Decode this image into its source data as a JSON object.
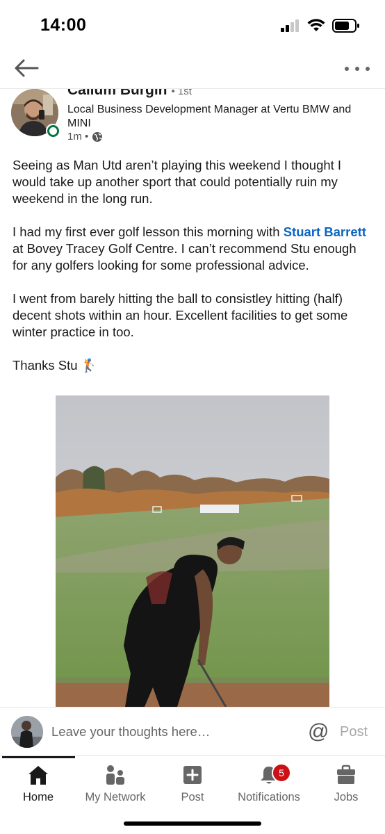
{
  "status_bar": {
    "time": "14:00"
  },
  "top_nav": {
    "back_icon": "arrow-left-icon",
    "more_icon": "more-horizontal-icon"
  },
  "post": {
    "author": {
      "name": "Callum Burgin",
      "degree": "• 1st",
      "headline": "Local Business Development Manager at Vertu BMW and MINI",
      "time": "1m •",
      "visibility_icon": "globe-icon"
    },
    "body": {
      "p1": "Seeing as Man Utd aren’t playing this weekend I thought I would take up another sport that could potentially ruin my weekend in the long run.",
      "p2_before": "I had my first ever golf lesson this morning with ",
      "p2_mention": "Stuart Barrett",
      "p2_after": " at Bovey Tracey Golf Centre. I can’t recommend Stu enough for any golfers looking for some professional advice.",
      "p3": "I went from barely hitting the ball to consistley hitting (half) decent shots within an hour. Excellent facilities to get some winter practice in too.",
      "p4": "Thanks Stu 🏌️"
    },
    "media": {
      "description_icon": "golf-photo"
    }
  },
  "comment_bar": {
    "placeholder": "Leave your thoughts here…",
    "at_symbol": "@",
    "post_label": "Post"
  },
  "bottom_nav": {
    "items": [
      {
        "label": "Home",
        "icon": "home-icon",
        "active": true
      },
      {
        "label": "My Network",
        "icon": "network-icon",
        "active": false
      },
      {
        "label": "Post",
        "icon": "plus-square-icon",
        "active": false
      },
      {
        "label": "Notifications",
        "icon": "bell-icon",
        "active": false,
        "badge": "5"
      },
      {
        "label": "Jobs",
        "icon": "briefcase-icon",
        "active": false
      }
    ]
  },
  "colors": {
    "link": "#0a66c2",
    "online": "#057642",
    "badge": "#cc1016"
  }
}
